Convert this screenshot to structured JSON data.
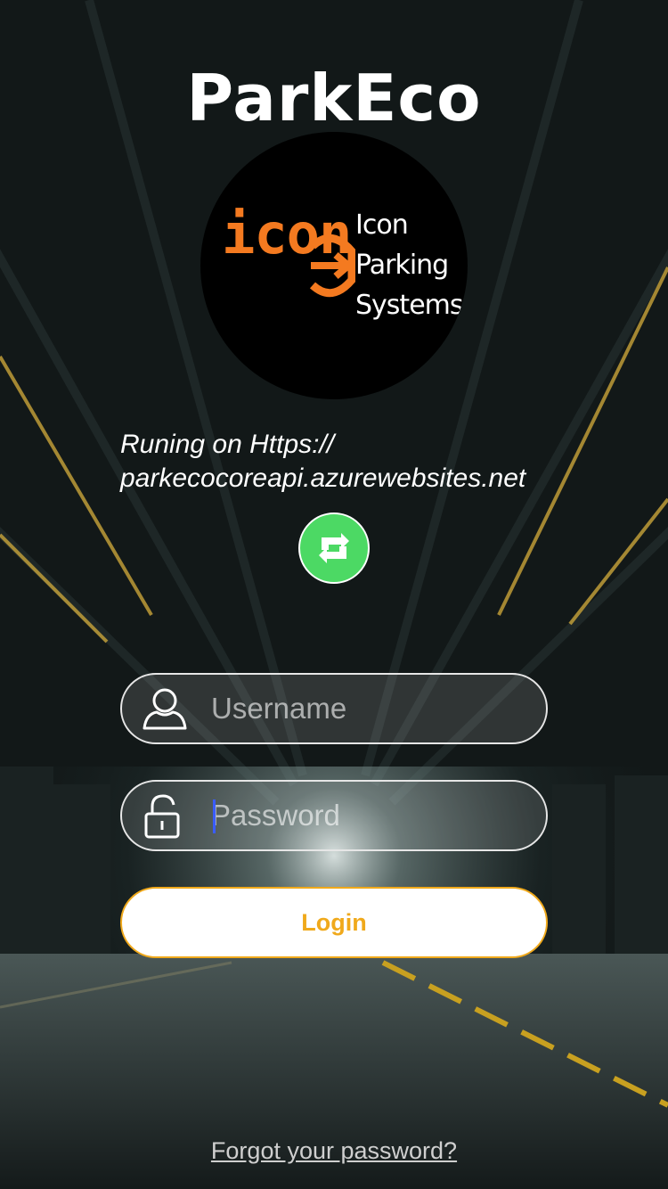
{
  "app": {
    "title": "ParkEco"
  },
  "logo": {
    "word": "icon",
    "name_lines": [
      "Icon",
      "Parking",
      "Systems"
    ],
    "accent_color": "#f47a20"
  },
  "server": {
    "line1": "Runing on Https://",
    "line2": "parkecocoreapi.azurewebsites.net"
  },
  "refresh_button": {
    "icon": "refresh-icon",
    "color": "#4cd964"
  },
  "form": {
    "username": {
      "placeholder": "Username",
      "value": "",
      "icon": "user-icon"
    },
    "password": {
      "placeholder": "Password",
      "value": "",
      "icon": "lock-icon"
    },
    "login_label": "Login",
    "login_color": "#f0a91b"
  },
  "forgot_password": "Forgot your password?"
}
